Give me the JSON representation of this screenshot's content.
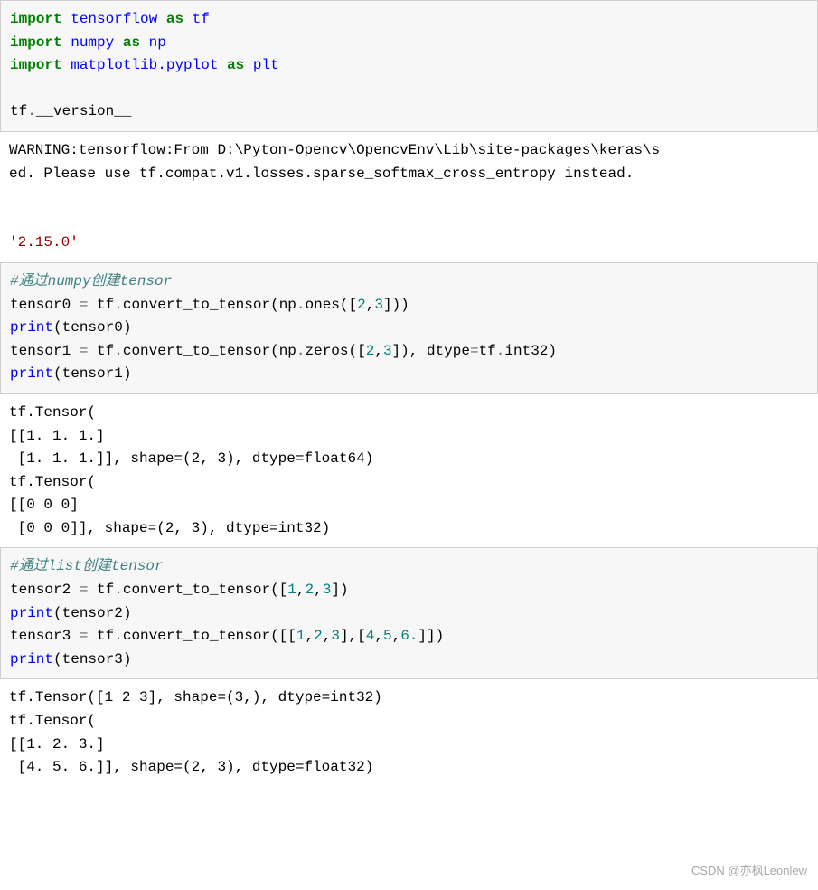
{
  "cell1": {
    "import": "import",
    "tensorflow": "tensorflow",
    "as": "as",
    "tf": "tf",
    "numpy": "numpy",
    "np": "np",
    "matplotlib_pyplot": "matplotlib.pyplot",
    "plt": "plt",
    "tf_dot": "tf",
    "version": "__version__"
  },
  "out1": {
    "warning_line1": "WARNING:tensorflow:From D:\\Pyton-Opencv\\OpencvEnv\\Lib\\site-packages\\keras\\s",
    "warning_line2": "ed. Please use tf.compat.v1.losses.sparse_softmax_cross_entropy instead.",
    "version_value": "'2.15.0'"
  },
  "cell2": {
    "comment": "#通过numpy创建tensor",
    "t0": "tensor0 ",
    "eq": "=",
    "tf_": " tf",
    "dot": ".",
    "convert": "convert_to_tensor",
    "lp": "(",
    "np_": "np",
    "ones": "ones",
    "lb": "([",
    "two": "2",
    "comma": ",",
    "three": "3",
    "rb": "]))",
    "print": "print",
    "t0p": "(tensor0)",
    "t1": "tensor1 ",
    "zeros": "zeros",
    "rb2": "]), dtype",
    "eq2": "=",
    "int32": "int32",
    "rp": ")",
    "t1p": "(tensor1)"
  },
  "out2": {
    "text": "tf.Tensor(\n[[1. 1. 1.]\n [1. 1. 1.]], shape=(2, 3), dtype=float64)\ntf.Tensor(\n[[0 0 0]\n [0 0 0]], shape=(2, 3), dtype=int32)"
  },
  "cell3": {
    "comment": "#通过list创建tensor",
    "t2": "tensor2 ",
    "eq": "=",
    "tf_": " tf",
    "dot": ".",
    "convert": "convert_to_tensor",
    "l1": "([",
    "one": "1",
    "c": ",",
    "two": "2",
    "three": "3",
    "r1": "])",
    "print": "print",
    "t2p": "(tensor2)",
    "t3": "tensor3 ",
    "l2": "([[",
    "r2": "],[",
    "four": "4",
    "five": "5",
    "six": "6.",
    "r3": "]])",
    "t3p": "(tensor3)"
  },
  "out3": {
    "text": "tf.Tensor([1 2 3], shape=(3,), dtype=int32)\ntf.Tensor(\n[[1. 2. 3.]\n [4. 5. 6.]], shape=(2, 3), dtype=float32)"
  },
  "watermark": "CSDN @亦枫Leonlew"
}
